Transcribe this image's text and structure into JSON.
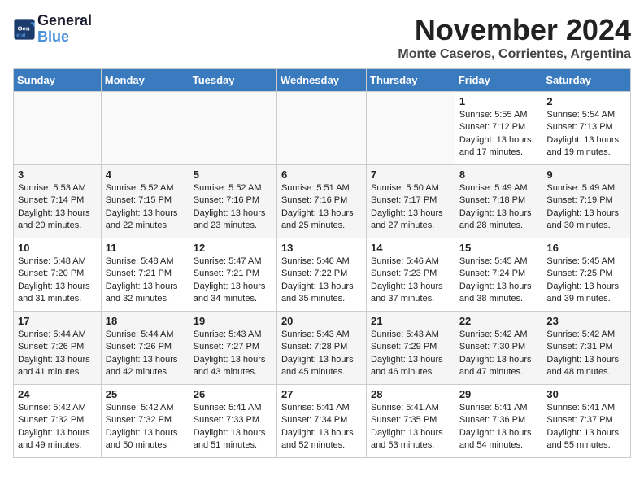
{
  "logo": {
    "line1": "General",
    "line2": "Blue"
  },
  "title": "November 2024",
  "subtitle": "Monte Caseros, Corrientes, Argentina",
  "days_header": [
    "Sunday",
    "Monday",
    "Tuesday",
    "Wednesday",
    "Thursday",
    "Friday",
    "Saturday"
  ],
  "weeks": [
    [
      {
        "day": "",
        "info": ""
      },
      {
        "day": "",
        "info": ""
      },
      {
        "day": "",
        "info": ""
      },
      {
        "day": "",
        "info": ""
      },
      {
        "day": "",
        "info": ""
      },
      {
        "day": "1",
        "info": "Sunrise: 5:55 AM\nSunset: 7:12 PM\nDaylight: 13 hours and 17 minutes."
      },
      {
        "day": "2",
        "info": "Sunrise: 5:54 AM\nSunset: 7:13 PM\nDaylight: 13 hours and 19 minutes."
      }
    ],
    [
      {
        "day": "3",
        "info": "Sunrise: 5:53 AM\nSunset: 7:14 PM\nDaylight: 13 hours and 20 minutes."
      },
      {
        "day": "4",
        "info": "Sunrise: 5:52 AM\nSunset: 7:15 PM\nDaylight: 13 hours and 22 minutes."
      },
      {
        "day": "5",
        "info": "Sunrise: 5:52 AM\nSunset: 7:16 PM\nDaylight: 13 hours and 23 minutes."
      },
      {
        "day": "6",
        "info": "Sunrise: 5:51 AM\nSunset: 7:16 PM\nDaylight: 13 hours and 25 minutes."
      },
      {
        "day": "7",
        "info": "Sunrise: 5:50 AM\nSunset: 7:17 PM\nDaylight: 13 hours and 27 minutes."
      },
      {
        "day": "8",
        "info": "Sunrise: 5:49 AM\nSunset: 7:18 PM\nDaylight: 13 hours and 28 minutes."
      },
      {
        "day": "9",
        "info": "Sunrise: 5:49 AM\nSunset: 7:19 PM\nDaylight: 13 hours and 30 minutes."
      }
    ],
    [
      {
        "day": "10",
        "info": "Sunrise: 5:48 AM\nSunset: 7:20 PM\nDaylight: 13 hours and 31 minutes."
      },
      {
        "day": "11",
        "info": "Sunrise: 5:48 AM\nSunset: 7:21 PM\nDaylight: 13 hours and 32 minutes."
      },
      {
        "day": "12",
        "info": "Sunrise: 5:47 AM\nSunset: 7:21 PM\nDaylight: 13 hours and 34 minutes."
      },
      {
        "day": "13",
        "info": "Sunrise: 5:46 AM\nSunset: 7:22 PM\nDaylight: 13 hours and 35 minutes."
      },
      {
        "day": "14",
        "info": "Sunrise: 5:46 AM\nSunset: 7:23 PM\nDaylight: 13 hours and 37 minutes."
      },
      {
        "day": "15",
        "info": "Sunrise: 5:45 AM\nSunset: 7:24 PM\nDaylight: 13 hours and 38 minutes."
      },
      {
        "day": "16",
        "info": "Sunrise: 5:45 AM\nSunset: 7:25 PM\nDaylight: 13 hours and 39 minutes."
      }
    ],
    [
      {
        "day": "17",
        "info": "Sunrise: 5:44 AM\nSunset: 7:26 PM\nDaylight: 13 hours and 41 minutes."
      },
      {
        "day": "18",
        "info": "Sunrise: 5:44 AM\nSunset: 7:26 PM\nDaylight: 13 hours and 42 minutes."
      },
      {
        "day": "19",
        "info": "Sunrise: 5:43 AM\nSunset: 7:27 PM\nDaylight: 13 hours and 43 minutes."
      },
      {
        "day": "20",
        "info": "Sunrise: 5:43 AM\nSunset: 7:28 PM\nDaylight: 13 hours and 45 minutes."
      },
      {
        "day": "21",
        "info": "Sunrise: 5:43 AM\nSunset: 7:29 PM\nDaylight: 13 hours and 46 minutes."
      },
      {
        "day": "22",
        "info": "Sunrise: 5:42 AM\nSunset: 7:30 PM\nDaylight: 13 hours and 47 minutes."
      },
      {
        "day": "23",
        "info": "Sunrise: 5:42 AM\nSunset: 7:31 PM\nDaylight: 13 hours and 48 minutes."
      }
    ],
    [
      {
        "day": "24",
        "info": "Sunrise: 5:42 AM\nSunset: 7:32 PM\nDaylight: 13 hours and 49 minutes."
      },
      {
        "day": "25",
        "info": "Sunrise: 5:42 AM\nSunset: 7:32 PM\nDaylight: 13 hours and 50 minutes."
      },
      {
        "day": "26",
        "info": "Sunrise: 5:41 AM\nSunset: 7:33 PM\nDaylight: 13 hours and 51 minutes."
      },
      {
        "day": "27",
        "info": "Sunrise: 5:41 AM\nSunset: 7:34 PM\nDaylight: 13 hours and 52 minutes."
      },
      {
        "day": "28",
        "info": "Sunrise: 5:41 AM\nSunset: 7:35 PM\nDaylight: 13 hours and 53 minutes."
      },
      {
        "day": "29",
        "info": "Sunrise: 5:41 AM\nSunset: 7:36 PM\nDaylight: 13 hours and 54 minutes."
      },
      {
        "day": "30",
        "info": "Sunrise: 5:41 AM\nSunset: 7:37 PM\nDaylight: 13 hours and 55 minutes."
      }
    ]
  ]
}
